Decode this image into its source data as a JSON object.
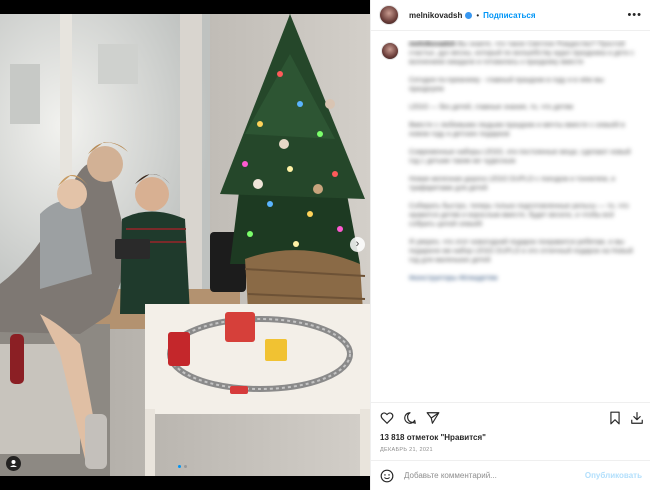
{
  "post": {
    "username": "melnikovadsh",
    "follow_label": "Подписаться",
    "separator": "•",
    "more_label": "•••",
    "likes_text": "13 818 отметок \"Нравится\"",
    "date_text": "ДЕКАБРЬ 21, 2021",
    "carousel": {
      "total": 2,
      "current": 1
    }
  },
  "caption": {
    "paragraphs": [
      "Вы знаете, что такое Светлое Рождество? Простой счастье, дух весны, который по волшебству ждал праздника и дети с волнением ожидали и готовились к празднику вместе",
      "Сегодня по-прежнему - главный праздник в году и в нём мы празднуем",
      "LEGO — без детей, главные знания, то, что детям",
      "Вместе с любимыми людьми праздник и мечты вместе с семьёй в новом году и детских подарков",
      "Современные наборы LEGO, эти постоянные вещи, сделают новый год с детьми таким же чудесным",
      "Новая железная дорога LEGO DUPLO с поездом и тоннелем, и трафаретами для детей",
      "Собирать быстро, теперь только подготовленные рельсы — то, что нравится детям и взрослым вместе, будет весело, и чтобы всё собрать целой семьёй",
      "Я уверен, что этот новогодний подарок понравится ребятам, и мы подарили им набор LEGO DUPLO и это отличный подарок на Новый год для маленьких детей"
    ],
    "hashtag": "#конструкторы #ёлкадетям"
  },
  "comment": {
    "placeholder": "Добавьте комментарий...",
    "publish_label": "Опубликовать"
  },
  "icons": {
    "like": "heart-icon",
    "comment": "comment-icon",
    "share": "share-icon",
    "save": "bookmark-icon",
    "download": "download-icon",
    "emoji": "emoji-icon",
    "next": "chevron-right-icon",
    "tagged": "user-tag-icon"
  },
  "colors": {
    "link": "#0095f6",
    "text": "#262626",
    "muted": "#8e8e8e",
    "publish_disabled": "#b2dffc"
  }
}
